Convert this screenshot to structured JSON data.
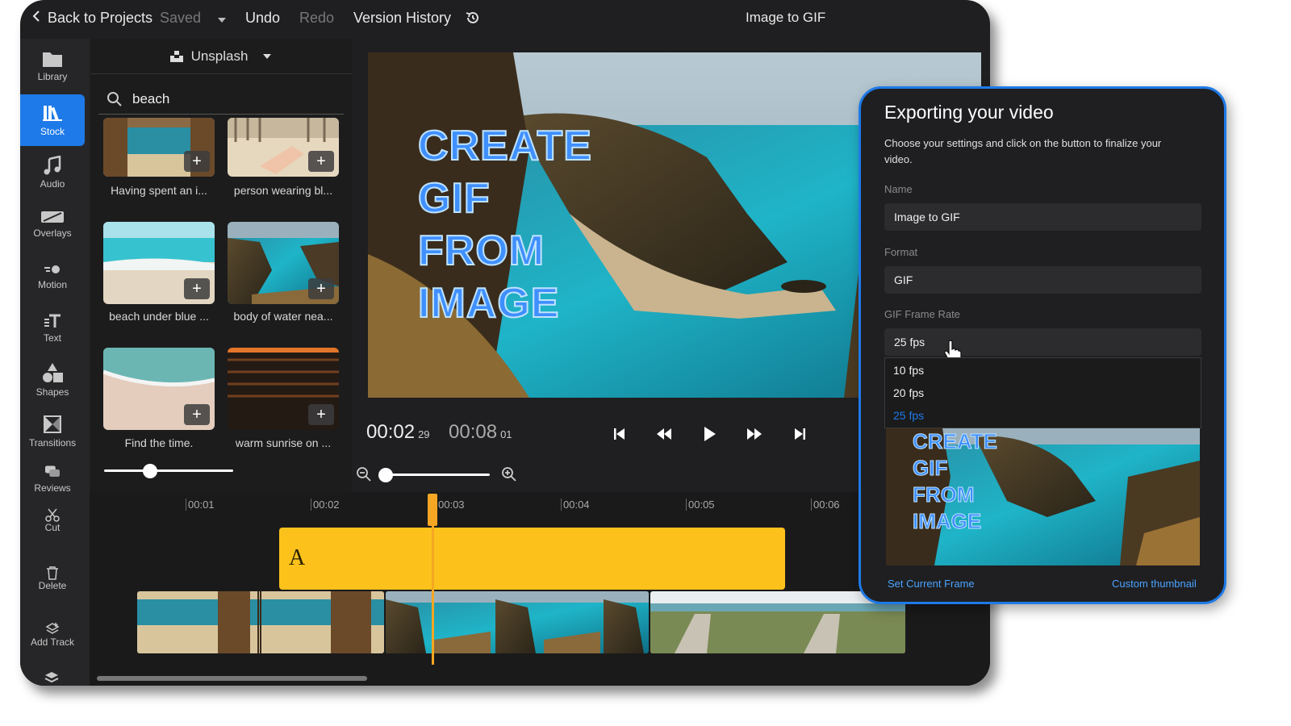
{
  "topbar": {
    "back_label": "Back to Projects",
    "saved_label": "Saved",
    "undo_label": "Undo",
    "redo_label": "Redo",
    "history_label": "Version History",
    "project_title": "Image to GIF"
  },
  "sidebar": {
    "items": [
      {
        "label": "Library",
        "icon": "folder-icon"
      },
      {
        "label": "Stock",
        "icon": "stock-icon"
      },
      {
        "label": "Audio",
        "icon": "music-icon"
      },
      {
        "label": "Overlays",
        "icon": "overlay-icon"
      },
      {
        "label": "Motion",
        "icon": "motion-icon"
      },
      {
        "label": "Text",
        "icon": "text-icon"
      },
      {
        "label": "Shapes",
        "icon": "shapes-icon"
      },
      {
        "label": "Transitions",
        "icon": "transitions-icon"
      },
      {
        "label": "Reviews",
        "icon": "comments-icon"
      }
    ]
  },
  "stock_panel": {
    "source": "Unsplash",
    "search_value": "beach",
    "results": [
      {
        "caption": "Having spent an i..."
      },
      {
        "caption": "person wearing bl..."
      },
      {
        "caption": "beach under blue ..."
      },
      {
        "caption": "body of water nea..."
      },
      {
        "caption": "Find the time."
      },
      {
        "caption": "warm sunrise on ..."
      }
    ],
    "add_symbol": "+"
  },
  "preview": {
    "overlay_lines": [
      "CREATE",
      "GIF",
      "FROM",
      "IMAGE"
    ]
  },
  "playback": {
    "current_time": "00:02",
    "current_frame": "29",
    "total_time": "00:08",
    "total_frame": "01"
  },
  "timeline": {
    "tools": [
      {
        "label": "Cut",
        "icon": "scissors-icon"
      },
      {
        "label": "Delete",
        "icon": "trash-icon"
      },
      {
        "label": "Add Track",
        "icon": "add-track-icon"
      }
    ],
    "ruler": [
      "00:01",
      "00:02",
      "00:03",
      "00:04",
      "00:05",
      "00:06"
    ],
    "text_clip_label": "A",
    "playhead_time": "00:02"
  },
  "export_dialog": {
    "title": "Exporting your video",
    "description": "Choose your settings and click on the button to finalize your video.",
    "name_label": "Name",
    "name_value": "Image to GIF",
    "format_label": "Format",
    "format_value": "GIF",
    "frame_rate_label": "GIF Frame Rate",
    "frame_rate_value": "25 fps",
    "frame_rate_options": [
      "10 fps",
      "20 fps",
      "25 fps"
    ],
    "thumbnail_lines": [
      "CREATE",
      "GIF",
      "FROM",
      "IMAGE"
    ],
    "set_frame_label": "Set Current Frame",
    "custom_thumb_label": "Custom thumbnail"
  },
  "colors": {
    "accent": "#1e7ae8",
    "text_clip": "#fcc21b",
    "playhead": "#f5a623"
  }
}
